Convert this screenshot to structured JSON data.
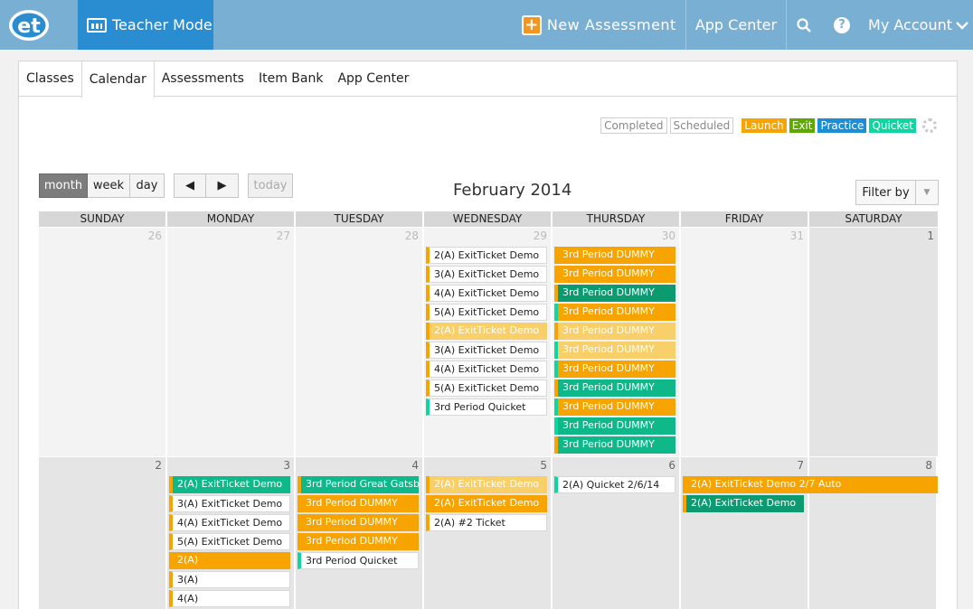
{
  "app": {
    "logo_text": "et",
    "teacher_mode": "Teacher Mode",
    "new_assessment": "New Assessment",
    "app_center": "App Center",
    "my_account": "My Account",
    "colors": {
      "topbar": "#7aafd4",
      "teacher_mode_bg": "#2a8dd1",
      "accent_orange": "#f7941d"
    }
  },
  "tabs": [
    "Classes",
    "Calendar",
    "Assessments",
    "Item Bank",
    "App Center"
  ],
  "active_tab": "Calendar",
  "legend": {
    "completed": "Completed",
    "scheduled": "Scheduled",
    "launch": "Launch",
    "exit": "Exit",
    "practice": "Practice",
    "quicket": "Quicket"
  },
  "toolbar": {
    "month": "month",
    "week": "week",
    "day": "day",
    "prev": "◀",
    "next": "▶",
    "today": "today",
    "title": "February 2014",
    "filter": "Filter by"
  },
  "days_of_week": [
    "SUNDAY",
    "MONDAY",
    "TUESDAY",
    "WEDNESDAY",
    "THURSDAY",
    "FRIDAY",
    "SATURDAY"
  ],
  "weeks": [
    {
      "days": [
        {
          "num": "26",
          "events": []
        },
        {
          "num": "27",
          "events": []
        },
        {
          "num": "28",
          "events": []
        },
        {
          "num": "29",
          "events": [
            {
              "label": "2(A) ExitTicket Demo",
              "style": "white",
              "bar": "bl-orange"
            },
            {
              "label": "3(A) ExitTicket Demo",
              "style": "white",
              "bar": "bl-orange"
            },
            {
              "label": "4(A) ExitTicket Demo",
              "style": "white",
              "bar": "bl-orange"
            },
            {
              "label": "5(A) ExitTicket Demo",
              "style": "white",
              "bar": "bl-orange"
            },
            {
              "label": "2(A) ExitTicket Demo",
              "style": "lightorange",
              "bar": "bl-orange"
            },
            {
              "label": "3(A) ExitTicket Demo",
              "style": "white",
              "bar": "bl-orange"
            },
            {
              "label": "4(A) ExitTicket Demo",
              "style": "white",
              "bar": "bl-orange"
            },
            {
              "label": "5(A) ExitTicket Demo",
              "style": "white",
              "bar": "bl-orange"
            },
            {
              "label": "3rd Period Quicket",
              "style": "white",
              "bar": "bl-teal"
            }
          ]
        },
        {
          "num": "30",
          "events": [
            {
              "label": "3rd Period DUMMY",
              "style": "orange",
              "bar": "bl-orange"
            },
            {
              "label": "3rd Period DUMMY",
              "style": "orange",
              "bar": "bl-orange"
            },
            {
              "label": "3rd Period DUMMY",
              "style": "darkteal",
              "bar": "bl-orange"
            },
            {
              "label": "3rd Period DUMMY",
              "style": "orange",
              "bar": "bl-teal"
            },
            {
              "label": "3rd Period DUMMY",
              "style": "lightorange",
              "bar": "bl-orange"
            },
            {
              "label": "3rd Period DUMMY",
              "style": "lightorange",
              "bar": "bl-teal"
            },
            {
              "label": "3rd Period DUMMY",
              "style": "orange",
              "bar": "bl-teal"
            },
            {
              "label": "3rd Period DUMMY",
              "style": "teal",
              "bar": "bl-orange"
            },
            {
              "label": "3rd Period DUMMY",
              "style": "orange",
              "bar": "bl-teal"
            },
            {
              "label": "3rd Period DUMMY",
              "style": "teal",
              "bar": "bl-teal"
            },
            {
              "label": "3rd Period DUMMY",
              "style": "teal",
              "bar": "bl-orange"
            }
          ]
        },
        {
          "num": "31",
          "events": []
        },
        {
          "num": "1",
          "events": []
        }
      ]
    },
    {
      "days": [
        {
          "num": "2",
          "events": []
        },
        {
          "num": "3",
          "events": [
            {
              "label": "2(A) ExitTicket Demo",
              "style": "teal",
              "bar": "bl-orange"
            },
            {
              "label": "3(A) ExitTicket Demo",
              "style": "white",
              "bar": "bl-orange"
            },
            {
              "label": "4(A) ExitTicket Demo",
              "style": "white",
              "bar": "bl-orange"
            },
            {
              "label": "5(A) ExitTicket Demo",
              "style": "white",
              "bar": "bl-orange"
            },
            {
              "label": "2(A)",
              "style": "orange",
              "bar": "bl-orange"
            },
            {
              "label": "3(A)",
              "style": "white",
              "bar": "bl-orange"
            },
            {
              "label": "4(A)",
              "style": "white",
              "bar": "bl-orange"
            }
          ]
        },
        {
          "num": "4",
          "events": [
            {
              "label": "3rd Period Great Gatsby",
              "style": "teal",
              "bar": "bl-orange"
            },
            {
              "label": "3rd Period DUMMY",
              "style": "orange",
              "bar": "bl-orange"
            },
            {
              "label": "3rd Period DUMMY",
              "style": "orange",
              "bar": "bl-orange"
            },
            {
              "label": "3rd Period DUMMY",
              "style": "orange",
              "bar": "bl-orange"
            },
            {
              "label": "3rd Period Quicket",
              "style": "white",
              "bar": "bl-teal"
            }
          ]
        },
        {
          "num": "5",
          "events": [
            {
              "label": "2(A) ExitTicket Demo",
              "style": "lightorange",
              "bar": "bl-orange"
            },
            {
              "label": "2(A) ExitTicket Demo",
              "style": "orange",
              "bar": "bl-orange"
            },
            {
              "label": "2(A) #2 Ticket",
              "style": "white",
              "bar": "bl-orange"
            }
          ]
        },
        {
          "num": "6",
          "events": [
            {
              "label": "2(A) Quicket 2/6/14",
              "style": "white",
              "bar": "bl-teal"
            }
          ]
        },
        {
          "num": "7",
          "events": [
            {
              "label": "2(A) ExitTicket Demo",
              "style": "darkteal",
              "bar": "bl-orange",
              "row": 1
            }
          ]
        },
        {
          "num": "8",
          "events": []
        }
      ],
      "spanning": {
        "label": "2(A) ExitTicket Demo 2/7 Auto",
        "style": "orange",
        "bar": "bl-orange"
      }
    }
  ]
}
